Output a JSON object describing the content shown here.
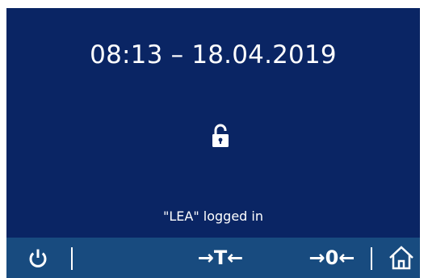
{
  "display": {
    "datetime": "08:13 – 18.04.2019",
    "lock_icon": "lock-open-icon",
    "status_text": "\"LEA\" logged in"
  },
  "toolbar": {
    "power_icon": "power-icon",
    "tare_label": "→T←",
    "zero_label": "→0←",
    "home_icon": "home-icon"
  },
  "colors": {
    "screen_background": "#0a2564",
    "toolbar_background": "#184b7f",
    "foreground": "#ffffff"
  }
}
